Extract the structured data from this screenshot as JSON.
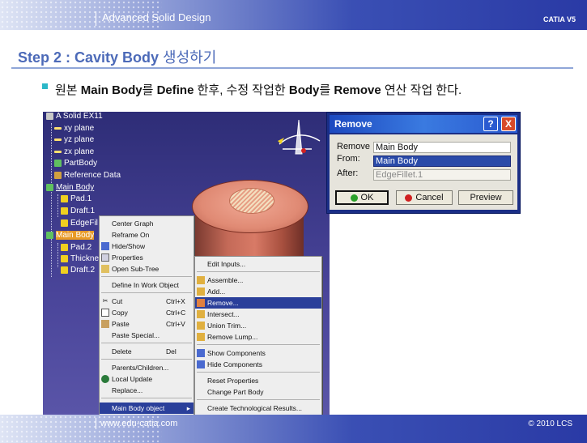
{
  "header": {
    "course_title": "Advanced Solid Design",
    "brand": "CATIA V5"
  },
  "slide": {
    "title_en": "Step 2 : Cavity Body ",
    "title_ko": "생성하기",
    "bullet_parts": [
      "원본 ",
      "Main Body",
      "를 ",
      "Define",
      " 한후, 수정 작업한 ",
      "Body",
      "를 ",
      "Remove",
      " 연산 작업 한다."
    ]
  },
  "tree": {
    "items": [
      {
        "label": "A Solid EX11"
      },
      {
        "label": "xy plane"
      },
      {
        "label": "yz plane"
      },
      {
        "label": "zx plane"
      },
      {
        "label": "PartBody"
      },
      {
        "label": "Reference Data"
      },
      {
        "label": "Main Body"
      },
      {
        "label": "Pad.1"
      },
      {
        "label": "Draft.1"
      },
      {
        "label": "EdgeFil"
      },
      {
        "label": "Main Body"
      },
      {
        "label": "Pad.2"
      },
      {
        "label": "Thickne"
      },
      {
        "label": "Draft.2"
      }
    ]
  },
  "context_menu": {
    "items": [
      {
        "label": "Center Graph",
        "shortcut": ""
      },
      {
        "label": "Reframe On",
        "shortcut": ""
      },
      {
        "label": "Hide/Show",
        "shortcut": ""
      },
      {
        "label": "Properties",
        "shortcut": ""
      },
      {
        "label": "Open Sub-Tree",
        "shortcut": ""
      },
      {
        "label": "Define In Work Object",
        "shortcut": ""
      },
      {
        "label": "Cut",
        "shortcut": "Ctrl+X"
      },
      {
        "label": "Copy",
        "shortcut": "Ctrl+C"
      },
      {
        "label": "Paste",
        "shortcut": "Ctrl+V"
      },
      {
        "label": "Paste Special...",
        "shortcut": ""
      },
      {
        "label": "Delete",
        "shortcut": "Del"
      },
      {
        "label": "Parents/Children...",
        "shortcut": ""
      },
      {
        "label": "Local Update",
        "shortcut": ""
      },
      {
        "label": "Replace...",
        "shortcut": ""
      },
      {
        "label": "Main Body object",
        "shortcut": ""
      }
    ]
  },
  "submenu": {
    "items": [
      {
        "label": "Edit Inputs..."
      },
      {
        "label": "Assemble..."
      },
      {
        "label": "Add..."
      },
      {
        "label": "Remove..."
      },
      {
        "label": "Intersect..."
      },
      {
        "label": "Union Trim..."
      },
      {
        "label": "Remove Lump..."
      },
      {
        "label": "Show Components"
      },
      {
        "label": "Hide Components"
      },
      {
        "label": "Reset Properties"
      },
      {
        "label": "Change Part Body"
      },
      {
        "label": "Create Technological Results..."
      }
    ]
  },
  "dialog": {
    "title": "Remove",
    "help_btn": "?",
    "close_btn": "X",
    "remove_label": "Remove",
    "remove_value": "Main Body",
    "from_label": "From:",
    "from_value": "Main Body",
    "after_label": "After:",
    "after_value": "EdgeFillet.1",
    "ok_label": "OK",
    "cancel_label": "Cancel",
    "preview_label": "Preview"
  },
  "footer": {
    "url": "www.edu-catia.com",
    "copyright": "© 2010 LCS"
  },
  "colors": {
    "title_blue": "#4c6ab8",
    "highlight_orange": "#e89a26",
    "dialog_blue": "#1a2e86"
  }
}
